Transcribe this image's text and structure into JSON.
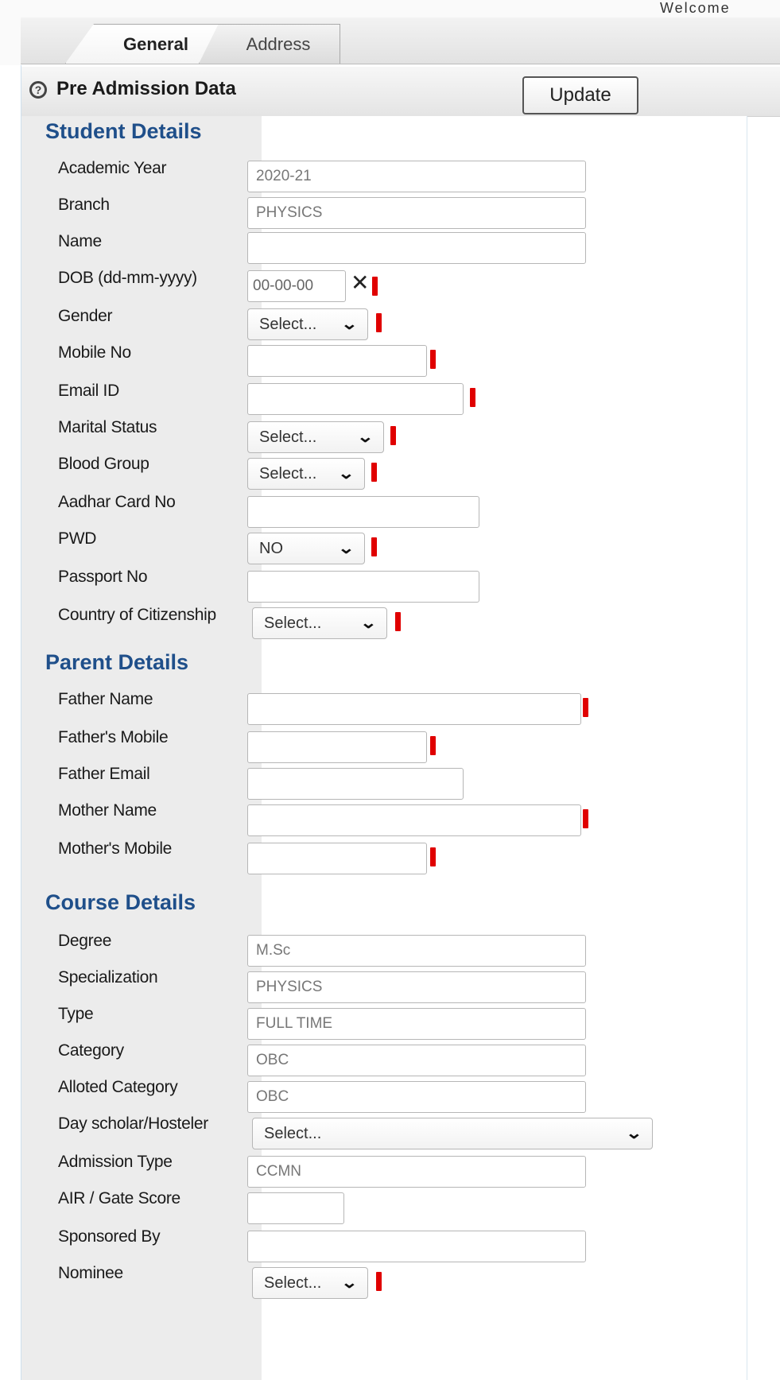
{
  "header": {
    "welcome_text": "Welcome"
  },
  "tabs": [
    {
      "label": "General"
    },
    {
      "label": "Address"
    }
  ],
  "panel": {
    "title": "Pre Admission Data",
    "update_label": "Update"
  },
  "student": {
    "heading": "Student Details",
    "academic_year": {
      "label": "Academic Year",
      "value": "2020-21"
    },
    "branch": {
      "label": "Branch",
      "value": "PHYSICS"
    },
    "name": {
      "label": "Name",
      "value": ""
    },
    "dob": {
      "label": "DOB (dd-mm-yyyy)",
      "value": "00-00-00",
      "clear": "✕"
    },
    "gender": {
      "label": "Gender",
      "value": "Select..."
    },
    "mobile": {
      "label": "Mobile No",
      "value": ""
    },
    "email": {
      "label": "Email ID",
      "value": ""
    },
    "marital": {
      "label": "Marital Status",
      "value": "Select..."
    },
    "blood": {
      "label": "Blood Group",
      "value": "Select..."
    },
    "aadhar": {
      "label": "Aadhar Card No",
      "value": ""
    },
    "pwd": {
      "label": "PWD",
      "value": "NO"
    },
    "passport": {
      "label": "Passport No",
      "value": ""
    },
    "citizenship": {
      "label": "Country of Citizenship",
      "value": "Select..."
    }
  },
  "parent": {
    "heading": "Parent Details",
    "father_name": {
      "label": "Father Name",
      "value": ""
    },
    "father_mobile": {
      "label": "Father's Mobile",
      "value": ""
    },
    "father_email": {
      "label": "Father Email",
      "value": ""
    },
    "mother_name": {
      "label": "Mother Name",
      "value": ""
    },
    "mother_mobile": {
      "label": "Mother's Mobile",
      "value": ""
    }
  },
  "course": {
    "heading": "Course Details",
    "degree": {
      "label": "Degree",
      "value": "M.Sc"
    },
    "specialization": {
      "label": "Specialization",
      "value": "PHYSICS"
    },
    "type": {
      "label": "Type",
      "value": "FULL TIME"
    },
    "category": {
      "label": "Category",
      "value": "OBC"
    },
    "allotted": {
      "label": "Alloted Category",
      "value": "OBC"
    },
    "day_scholar": {
      "label": "Day scholar/Hosteler",
      "value": "Select..."
    },
    "admission_type": {
      "label": "Admission Type",
      "value": "CCMN"
    },
    "air_gate": {
      "label": "AIR / Gate Score",
      "value": ""
    },
    "sponsored": {
      "label": "Sponsored By",
      "value": ""
    },
    "nominee": {
      "label": "Nominee",
      "value": "Select..."
    }
  },
  "colors": {
    "heading": "#1f4f8a",
    "required": "#e00000",
    "label_bg": "#ececec"
  }
}
